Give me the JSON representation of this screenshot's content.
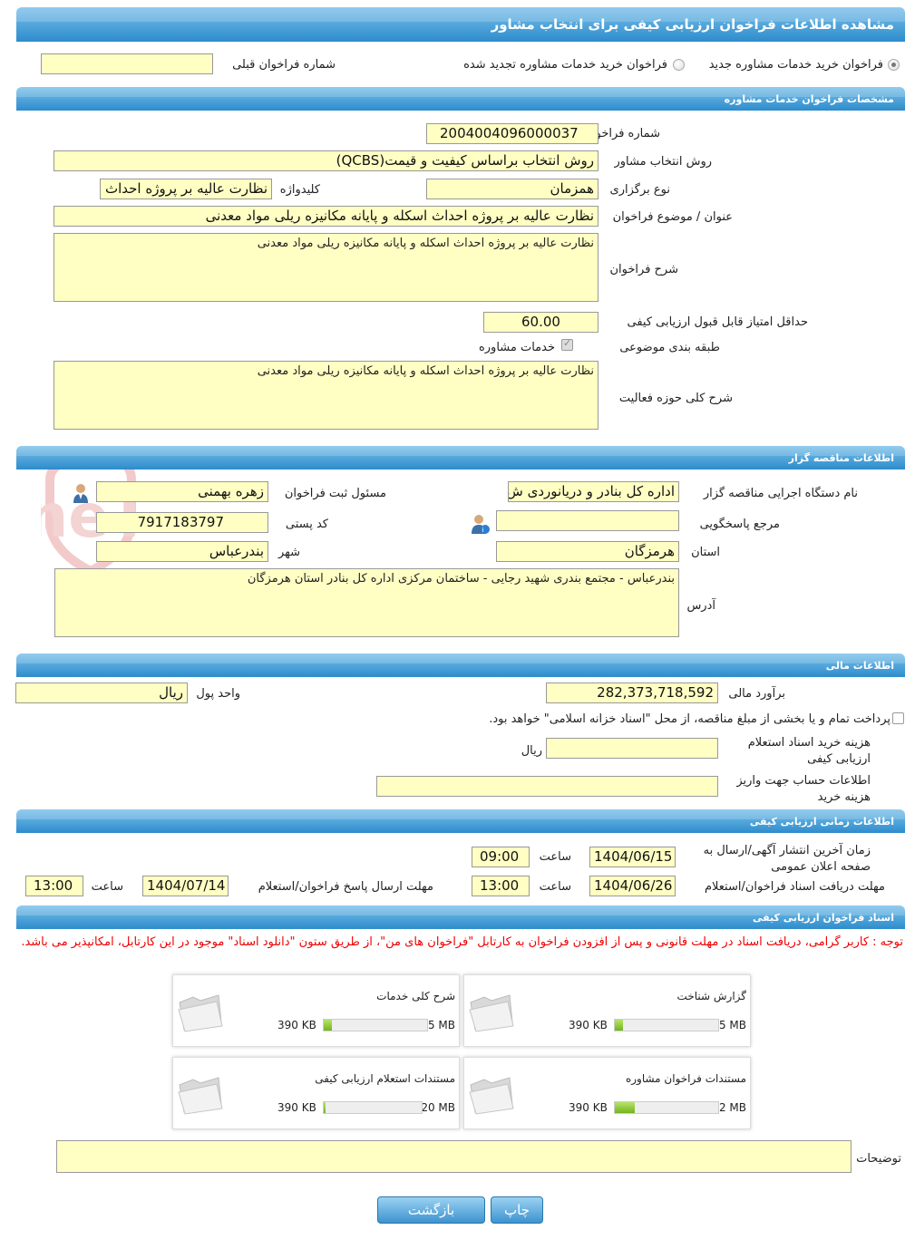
{
  "page": {
    "title": "مشاهده اطلاعات فراخوان ارزیابی کیفی برای انتخاب مشاور"
  },
  "top": {
    "radio_new": "فراخوان خرید خدمات مشاوره جدید",
    "radio_renewed": "فراخوان خرید خدمات مشاوره تجدید شده",
    "prev_label": "شماره فراخوان قبلی",
    "prev_value": ""
  },
  "specs": {
    "header": "مشخصات فراخوان خدمات مشاوره",
    "number_label": "شماره فراخوان",
    "number_value": "2004004096000037",
    "method_label": "روش انتخاب مشاور",
    "method_value": "روش انتخاب براساس کیفیت و قیمت(QCBS)",
    "type_label": "نوع برگزاری",
    "type_value": "همزمان",
    "keyword_label": "کلیدواژه",
    "keyword_value": "نظارت عالیه بر پروژه احداث",
    "subject_label": "عنوان / موضوع فراخوان",
    "subject_value": "نظارت عالیه بر پروژه احداث اسکله و پایانه مکانیزه ریلی مواد معدنی",
    "desc_label": "شرح فراخوان",
    "desc_value": "نظارت عالیه بر پروژه احداث اسکله و پایانه مکانیزه ریلی مواد معدنی",
    "minscore_label": "حداقل امتیاز قابل قبول ارزیابی کیفی",
    "minscore_value": "60.00",
    "category_label": "طبقه بندی موضوعی",
    "category_value": "خدمات مشاوره",
    "scope_label": "شرح کلی حوزه فعالیت",
    "scope_value": "نظارت عالیه بر پروژه احداث اسکله و پایانه مکانیزه ریلی مواد معدنی"
  },
  "org": {
    "header": "اطلاعات مناقصه گزار",
    "name_label": "نام دستگاه اجرایی مناقصه گزار",
    "name_value": "اداره کل بنادر و دریانوردی ش",
    "registrar_label": "مسئول ثبت فراخوان",
    "registrar_value": "زهره بهمنی",
    "ref_label": "مرجع پاسخگویی",
    "ref_value": "",
    "postal_label": "کد پستی",
    "postal_value": "7917183797",
    "province_label": "استان",
    "province_value": "هرمزگان",
    "city_label": "شهر",
    "city_value": "بندرعباس",
    "address_label": "آدرس",
    "address_value": "بندرعباس - مجتمع بندری شهید رجایی - ساختمان مرکزی اداره کل بنادر استان هرمزگان"
  },
  "finance": {
    "header": "اطلاعات مالی",
    "estimate_label": "برآورد مالی",
    "estimate_value": "282,373,718,592",
    "currency_label": "واحد پول",
    "currency_value": "ریال",
    "treasury_text": "پرداخت تمام و یا بخشی از مبلغ مناقصه، از محل \"اسناد خزانه اسلامی\" خواهد بود.",
    "doccost_label": "هزینه خرید اسناد استعلام ارزیابی کیفی",
    "doccost_value": "",
    "doccost_unit": "ریال",
    "account_label": "اطلاعات حساب جهت واریز هزینه خرید",
    "account_value": ""
  },
  "timing": {
    "header": "اطلاعات زمانی ارزیابی کیفی",
    "publish_label": "زمان آخرین انتشار آگهی/ارسال به صفحه اعلان عمومی",
    "publish_date": "1404/06/15",
    "publish_time": "09:00",
    "time_label": "ساعت",
    "receive_label": "مهلت دریافت اسناد فراخوان/استعلام",
    "receive_date": "1404/06/26",
    "receive_time": "13:00",
    "send_label": "مهلت ارسال پاسخ فراخوان/استعلام",
    "send_date": "1404/07/14",
    "send_time": "13:00"
  },
  "docs": {
    "header": "اسناد فراخوان ارزیابی کیفی",
    "notice": "توجه : کاربر گرامی، دریافت اسناد در مهلت قانونی و پس از افزودن فراخوان به کارتابل \"فراخوان های من\"، از طریق ستون \"دانلود اسناد\" موجود در این کارتابل، امکانپذیر می باشد.",
    "files": [
      {
        "title": "گزارش شناخت",
        "size": "390 KB",
        "max": "5 MB",
        "ratio": 0.076
      },
      {
        "title": "شرح کلی خدمات",
        "size": "390 KB",
        "max": "5 MB",
        "ratio": 0.076
      },
      {
        "title": "مستندات فراخوان مشاوره",
        "size": "390 KB",
        "max": "2 MB",
        "ratio": 0.19
      },
      {
        "title": "مستندات استعلام ارزیابی کیفی",
        "size": "390 KB",
        "max": "20 MB",
        "ratio": 0.019
      }
    ],
    "notes_label": "توضیحات",
    "notes_value": ""
  },
  "actions": {
    "print": "چاپ",
    "back": "بازگشت"
  },
  "watermark": "AriaTender.neT",
  "colors": {
    "header_top": "#7ac0ea",
    "header_bottom": "#2d8ccc",
    "field_bg": "#ffffc4",
    "notice": "#e00000"
  }
}
